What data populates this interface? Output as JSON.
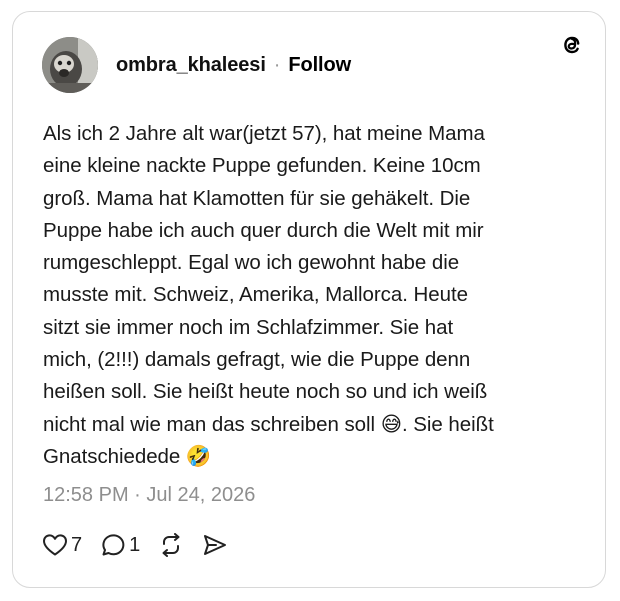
{
  "post": {
    "username": "ombra_khaleesi",
    "separator": "·",
    "follow_label": "Follow",
    "text": "Als ich 2 Jahre alt war(jetzt 57), hat meine Mama\neine kleine nackte Puppe gefunden. Keine 10cm\ngroß. Mama hat Klamotten für sie gehäkelt. Die\nPuppe habe ich auch quer durch die Welt mit mir\nrumgeschleppt. Egal wo ich gewohnt habe die\nmusste mit. Schweiz, Amerika, Mallorca. Heute\nsitzt sie immer noch im Schlafzimmer. Sie hat\nmich, (2!!!) damals gefragt, wie die Puppe denn\nheißen soll. Sie heißt heute noch so und ich weiß\nnicht mal wie man das schreiben soll 😅. Sie heißt\nGnatschiedede 🤣",
    "timestamp": "12:58 PM · Jul 24, 2026"
  },
  "actions": {
    "likes": "7",
    "replies": "1"
  },
  "icons": {
    "brand": "threads-logo-icon",
    "like": "heart-icon",
    "reply": "comment-icon",
    "repost": "repost-icon",
    "share": "send-icon"
  }
}
